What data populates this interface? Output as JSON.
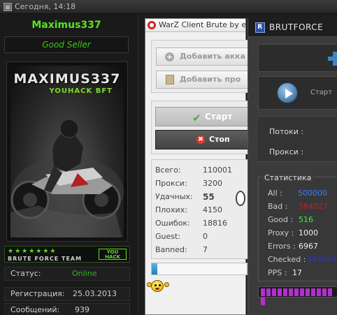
{
  "post": {
    "date": "Сегодня, 14:18"
  },
  "user": {
    "name": "Maximus337",
    "title": "Good Seller",
    "avatar_title": "MAXIMUS337",
    "avatar_subtitle": "YOUHACK BFT",
    "team_label": "BRUTE FORCE TEAM",
    "team_stars": "★★★★★★★",
    "team_badge_line1": "YOU",
    "team_badge_line2": "HACK",
    "status_label": "Статус:",
    "status_value": "Online",
    "reg_label": "Регистрация:",
    "reg_value": "25.03.2013",
    "msgs_label": "Сообщений:",
    "msgs_value": "939"
  },
  "mid": {
    "title": "WarZ Client Brute by e",
    "add_account": "Добавить акка",
    "add_proxy": "Добавить про",
    "start": "Старт",
    "stop": "Стоп",
    "stop_glyph": "✖",
    "stats": [
      {
        "label": "Всего:",
        "value": "110001"
      },
      {
        "label": "Прокси:",
        "value": "3200"
      },
      {
        "label": "Удачных:",
        "value": "55"
      },
      {
        "label": "Плохих:",
        "value": "4150"
      },
      {
        "label": "Ошибок:",
        "value": "18816"
      },
      {
        "label": "Guest:",
        "value": "0"
      },
      {
        "label": "Banned:",
        "value": "7"
      }
    ],
    "progress": 0.06
  },
  "right": {
    "title": "BRUTFORCE",
    "icon_letter": "R",
    "start": "Старт",
    "threads_label": "Потоки :",
    "proxy_label": "Прокси :",
    "stats_title": "Статистика",
    "stats": [
      {
        "label": "All :",
        "value": "500000",
        "color": "#3c7cff"
      },
      {
        "label": "Bad :",
        "value": "384027",
        "color": "#c81e1e"
      },
      {
        "label": "Good :",
        "value": "516",
        "color": "#3cf03c"
      },
      {
        "label": "Proxy :",
        "value": "1000",
        "color": "#f0f0f0"
      },
      {
        "label": "Errors :",
        "value": "6967",
        "color": "#f0f0f0"
      },
      {
        "label": "Checked :",
        "value": "384049",
        "color": "#2a35d0"
      },
      {
        "label": "PPS :",
        "value": "17",
        "color": "#f0f0f0"
      }
    ],
    "progress_segments": 14
  },
  "colors": {
    "online": "#2fb51f",
    "username": "#59e31f"
  }
}
